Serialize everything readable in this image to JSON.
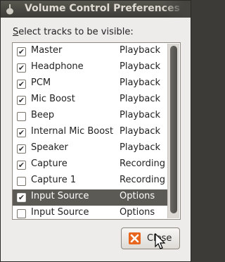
{
  "window": {
    "title": "Volume Control Preferences"
  },
  "prompt": {
    "text": "elect tracks to be visible:",
    "mnemonic": "S"
  },
  "tracks": [
    {
      "name": "Master",
      "type": "Playback",
      "checked": true,
      "selected": false
    },
    {
      "name": "Headphone",
      "type": "Playback",
      "checked": true,
      "selected": false
    },
    {
      "name": "PCM",
      "type": "Playback",
      "checked": true,
      "selected": false
    },
    {
      "name": "Mic Boost",
      "type": "Playback",
      "checked": true,
      "selected": false
    },
    {
      "name": "Beep",
      "type": "Playback",
      "checked": false,
      "selected": false
    },
    {
      "name": "Internal Mic Boost",
      "type": "Playback",
      "checked": true,
      "selected": false
    },
    {
      "name": "Speaker",
      "type": "Playback",
      "checked": true,
      "selected": false
    },
    {
      "name": "Capture",
      "type": "Recording",
      "checked": true,
      "selected": false
    },
    {
      "name": "Capture 1",
      "type": "Recording",
      "checked": false,
      "selected": false
    },
    {
      "name": "Input Source",
      "type": "Options",
      "checked": true,
      "selected": true
    },
    {
      "name": "Input Source",
      "type": "Options",
      "checked": false,
      "selected": false
    }
  ],
  "buttons": {
    "close_label": "Close"
  },
  "colors": {
    "titlebar": "#3d3c37",
    "selection": "#5b5a55",
    "close_icon": "#e8651d"
  }
}
